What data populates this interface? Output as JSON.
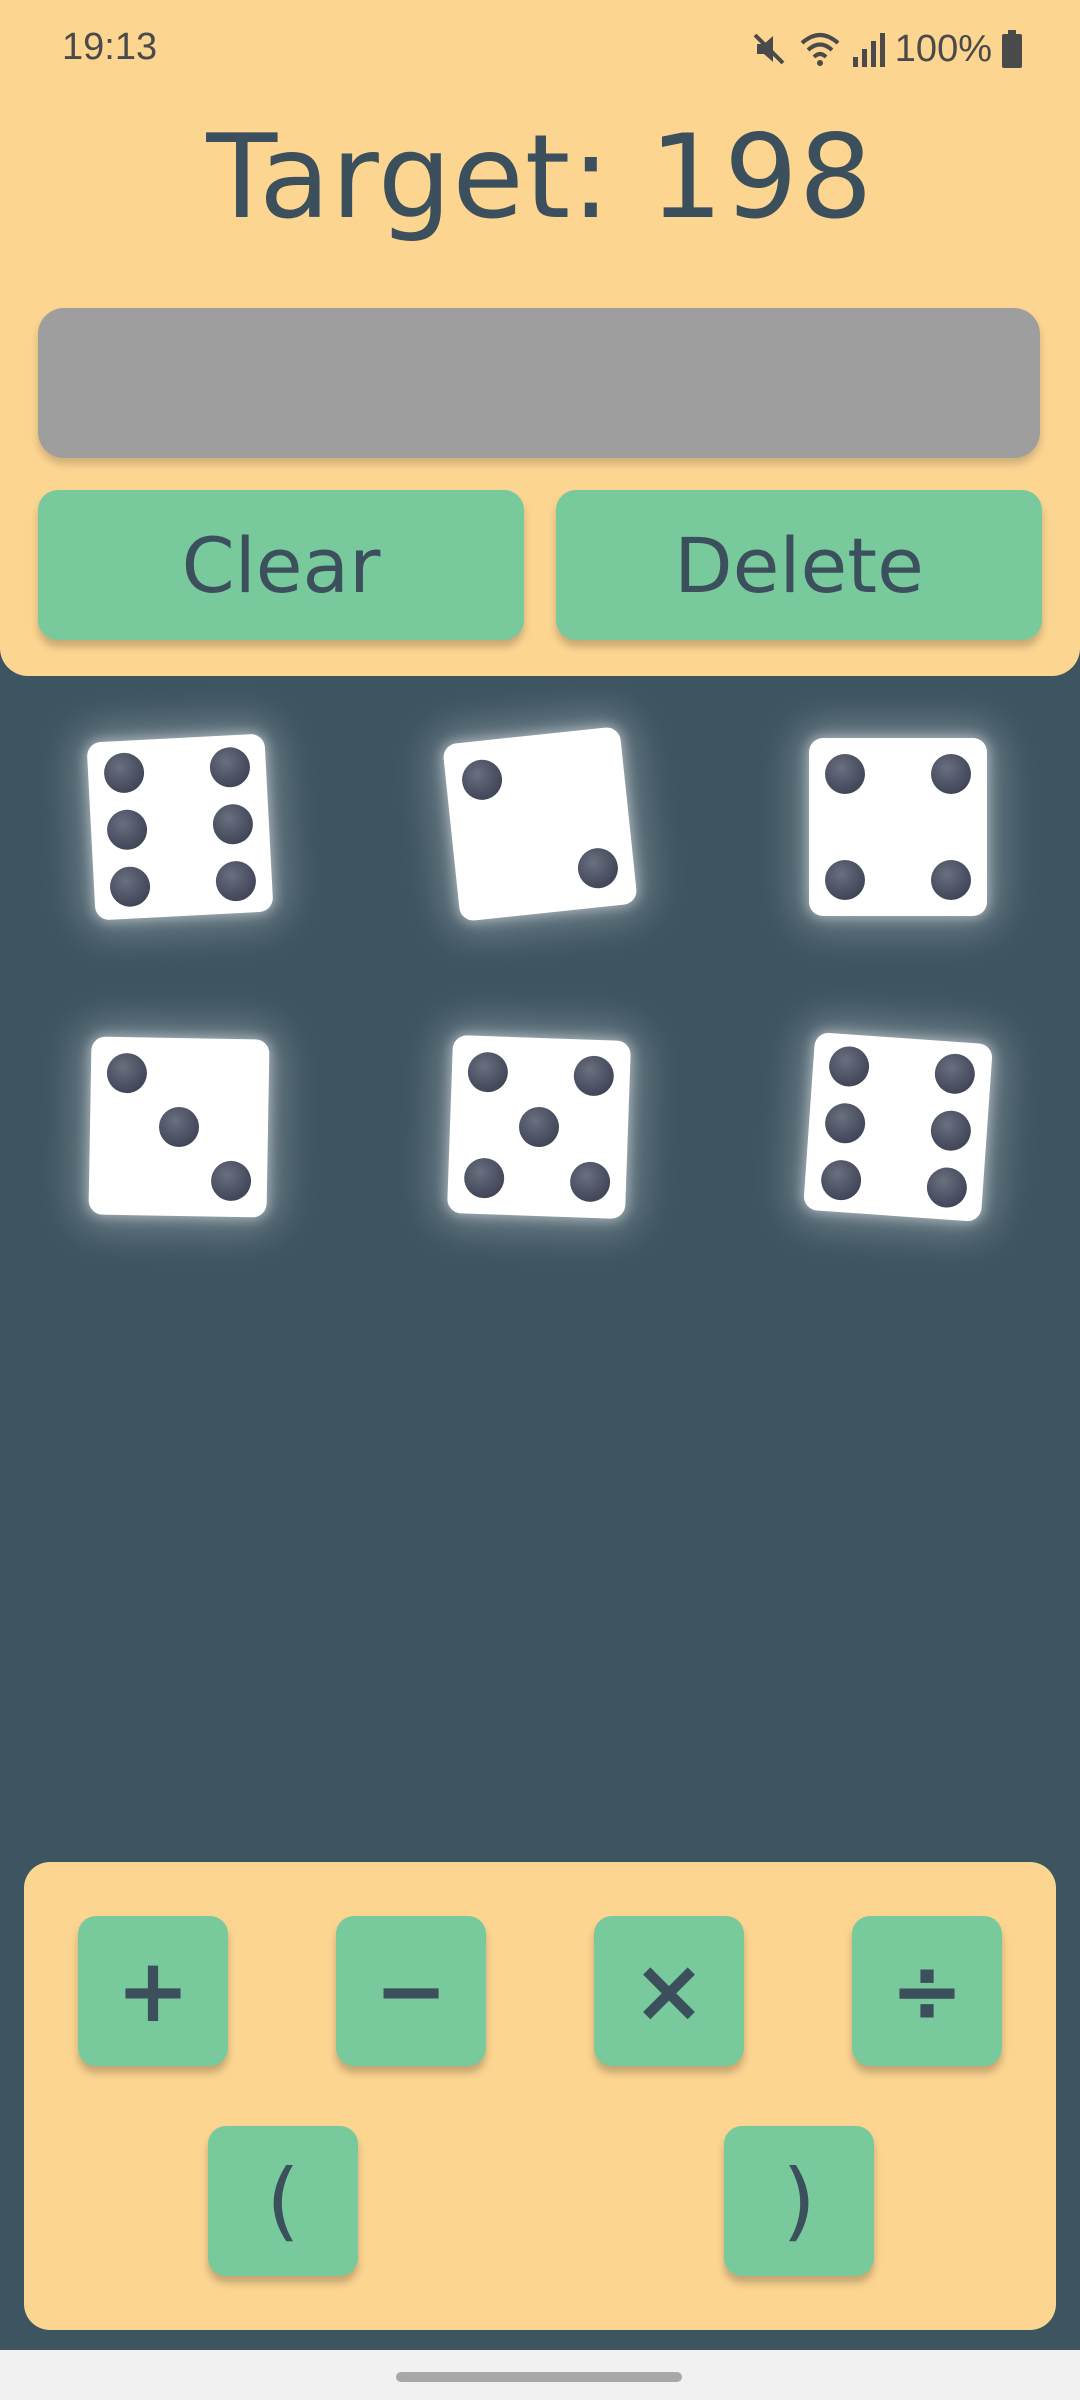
{
  "status": {
    "time": "19:13",
    "battery": "100%",
    "icons": [
      "mute-icon",
      "wifi-icon",
      "signal-icon",
      "battery-icon"
    ]
  },
  "target": {
    "label": "Target: 198"
  },
  "expression": {
    "value": ""
  },
  "actions": {
    "clear": "Clear",
    "delete": "Delete"
  },
  "dice": [
    {
      "value": 6
    },
    {
      "value": 2
    },
    {
      "value": 4
    },
    {
      "value": 3
    },
    {
      "value": 5
    },
    {
      "value": 6
    }
  ],
  "operators": {
    "plus": "+",
    "minus": "−",
    "times": "×",
    "divide": "÷",
    "open_paren": "(",
    "close_paren": ")"
  },
  "colors": {
    "panel": "#fcd591",
    "background": "#3d5461",
    "button": "#78c99c",
    "text": "#3b4f5c",
    "expression_field": "#9e9e9e"
  }
}
